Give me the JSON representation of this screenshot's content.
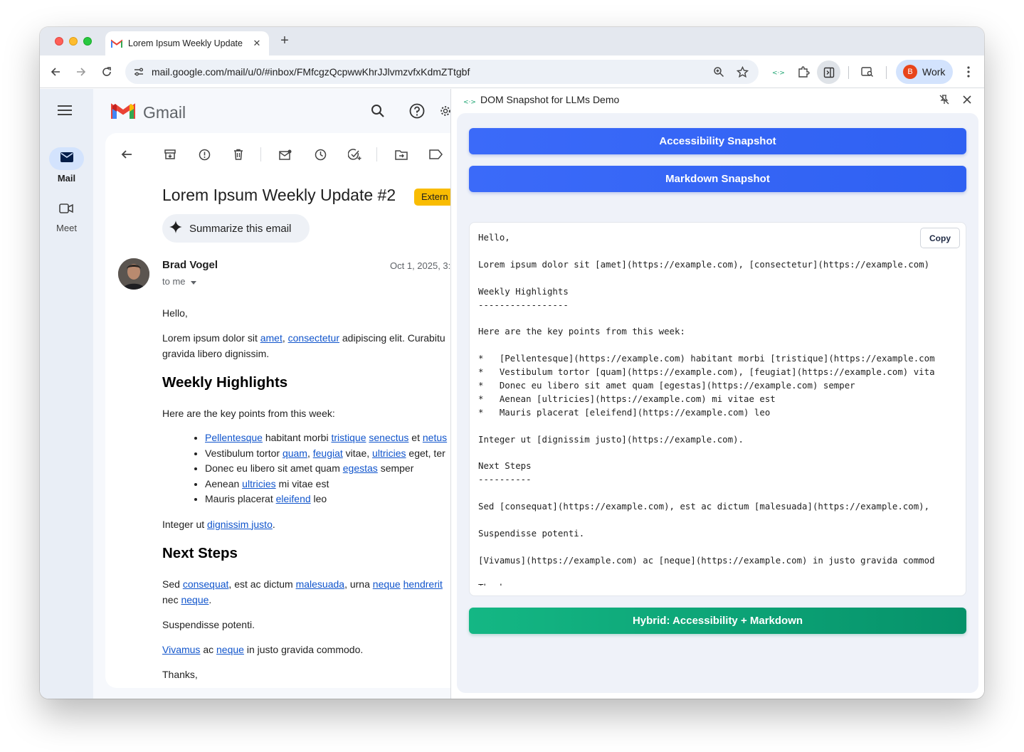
{
  "browser": {
    "tab_title": "Lorem Ipsum Weekly Update",
    "new_tab_symbol": "+",
    "url": "mail.google.com/mail/u/0/#inbox/FMfcgzQcpwwKhrJJlvmzvfxKdmZTtgbf",
    "profile_initial": "B",
    "profile_label": "Work"
  },
  "gmail": {
    "logo_text": "Gmail",
    "rail": {
      "mail_label": "Mail",
      "meet_label": "Meet"
    },
    "subject": "Lorem Ipsum Weekly Update #2",
    "external_badge": "Extern",
    "summarize_label": "Summarize this email",
    "sender_name": "Brad Vogel",
    "date": "Oct 1, 2025, 3:",
    "to_me": "to me",
    "body": {
      "greeting": "Hello,",
      "p1_a": "Lorem ipsum dolor sit ",
      "p1_link1": "amet",
      "p1_b": ", ",
      "p1_link2": "consectetur",
      "p1_c": " adipiscing elit. Curabitu",
      "p1_line2": "gravida libero dignissim.",
      "h_weekly": "Weekly Highlights",
      "intro": "Here are the key points from this week:",
      "li1_link1": "Pellentesque",
      "li1_a": " habitant morbi ",
      "li1_link2": "tristique",
      "li1_b": " ",
      "li1_link3": "senectus",
      "li1_c": " et ",
      "li1_link4": "netus",
      "li2_a": "Vestibulum tortor ",
      "li2_link1": "quam",
      "li2_b": ", ",
      "li2_link2": "feugiat",
      "li2_c": " vitae, ",
      "li2_link3": "ultricies",
      "li2_d": " eget, ter",
      "li3_a": "Donec eu libero sit amet quam ",
      "li3_link1": "egestas",
      "li3_b": " semper",
      "li4_a": "Aenean ",
      "li4_link1": "ultricies",
      "li4_b": " mi vitae est",
      "li5_a": "Mauris placerat ",
      "li5_link1": "eleifend",
      "li5_b": " leo",
      "p_integer_a": "Integer ut ",
      "p_integer_link": "dignissim justo",
      "p_integer_b": ".",
      "h_next": "Next Steps",
      "p_sed_a": "Sed ",
      "p_sed_link1": "consequat",
      "p_sed_b": ", est ac dictum ",
      "p_sed_link2": "malesuada",
      "p_sed_c": ", urna ",
      "p_sed_link3": "neque",
      "p_sed_d": " ",
      "p_sed_link4": "hendrerit",
      "p_sed_line2_a": "nec ",
      "p_sed_line2_link": "neque",
      "p_sed_line2_b": ".",
      "p_susp": "Suspendisse potenti.",
      "p_viv_link1": "Vivamus",
      "p_viv_a": " ac ",
      "p_viv_link2": "neque",
      "p_viv_b": " in justo gravida commodo.",
      "thanks": "Thanks,"
    }
  },
  "panel": {
    "title": "DOM Snapshot for LLMs Demo",
    "btn_accessibility": "Accessibility Snapshot",
    "btn_markdown": "Markdown Snapshot",
    "btn_hybrid": "Hybrid: Accessibility + Markdown",
    "copy_label": "Copy",
    "markdown_output": "Hello,\n\nLorem ipsum dolor sit [amet](https://example.com), [consectetur](https://example.com)\n\nWeekly Highlights\n-----------------\n\nHere are the key points from this week:\n\n*   [Pellentesque](https://example.com) habitant morbi [tristique](https://example.com\n*   Vestibulum tortor [quam](https://example.com), [feugiat](https://example.com) vita\n*   Donec eu libero sit amet quam [egestas](https://example.com) semper\n*   Aenean [ultricies](https://example.com) mi vitae est\n*   Mauris placerat [eleifend](https://example.com) leo\n\nInteger ut [dignissim justo](https://example.com).\n\nNext Steps\n----------\n\nSed [consequat](https://example.com), est ac dictum [malesuada](https://example.com),\n\nSuspendisse potenti.\n\n[Vivamus](https://example.com) ac [neque](https://example.com) in justo gravida commod\n\nThanks,"
  },
  "colors": {
    "accent_blue": "#2f61f2",
    "accent_green": "#0ea374",
    "link": "#1155cc",
    "badge_yellow": "#f9bc02",
    "profile_red": "#e8441a"
  }
}
